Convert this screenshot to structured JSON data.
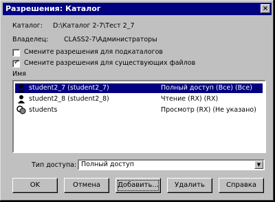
{
  "window": {
    "title": "Разрешения: Каталог",
    "close_glyph": "×"
  },
  "info": {
    "catalog_label": "Каталог:",
    "catalog_value": "D:\\Каталог 2-7\\Тест 2_7",
    "owner_label": "Владелец:",
    "owner_value": "CLASS2-7\\Администраторы"
  },
  "options": {
    "replace_subdirs": {
      "label": "Смените разрешения для подкаталогов",
      "checked": false
    },
    "replace_files": {
      "label": "Смените разрешения для существующих файлов",
      "checked": true
    }
  },
  "names_label": "Имя",
  "users": [
    {
      "name": "student2_7 (student2_7)",
      "permission": "Полный доступ (Все) (Все)",
      "icon": "user-icon",
      "selected": true
    },
    {
      "name": "student2_8 (student2_8)",
      "permission": "Чтение (RX) (RX)",
      "icon": "user-icon",
      "selected": false
    },
    {
      "name": "students",
      "permission": "Просмотр (RX) (Не указано)",
      "icon": "group-icon",
      "selected": false
    }
  ],
  "access_type": {
    "label": "Тип доступа:",
    "value": "Полный доступ",
    "dropdown_glyph": "▼"
  },
  "buttons": {
    "ok": "OK",
    "cancel": "Отмена",
    "add": "Добавить...",
    "remove": "Удалить",
    "help": "Справка"
  }
}
